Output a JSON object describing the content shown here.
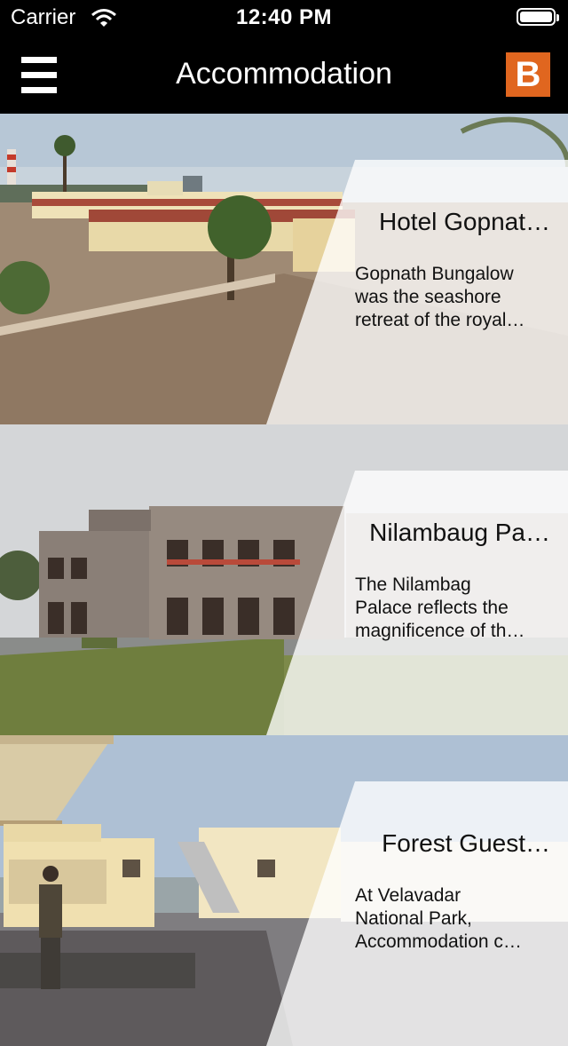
{
  "status_bar": {
    "carrier": "Carrier",
    "time": "12:40 PM",
    "battery_level": 1.0
  },
  "nav": {
    "title": "Accommodation",
    "brand_letter": "B",
    "brand_color": "#e0661f"
  },
  "items": [
    {
      "title": "Hotel Gopnat…",
      "desc_lines": [
        "Gopnath Bungalow",
        "was the seashore",
        "retreat of the royal…"
      ]
    },
    {
      "title": "Nilambaug Pa…",
      "desc_lines": [
        "The Nilambag",
        "Palace reflects the",
        "magnificence of th…"
      ]
    },
    {
      "title": "Forest Guest…",
      "desc_lines": [
        "At Velavadar",
        "National Park,",
        "Accommodation c…"
      ]
    }
  ]
}
